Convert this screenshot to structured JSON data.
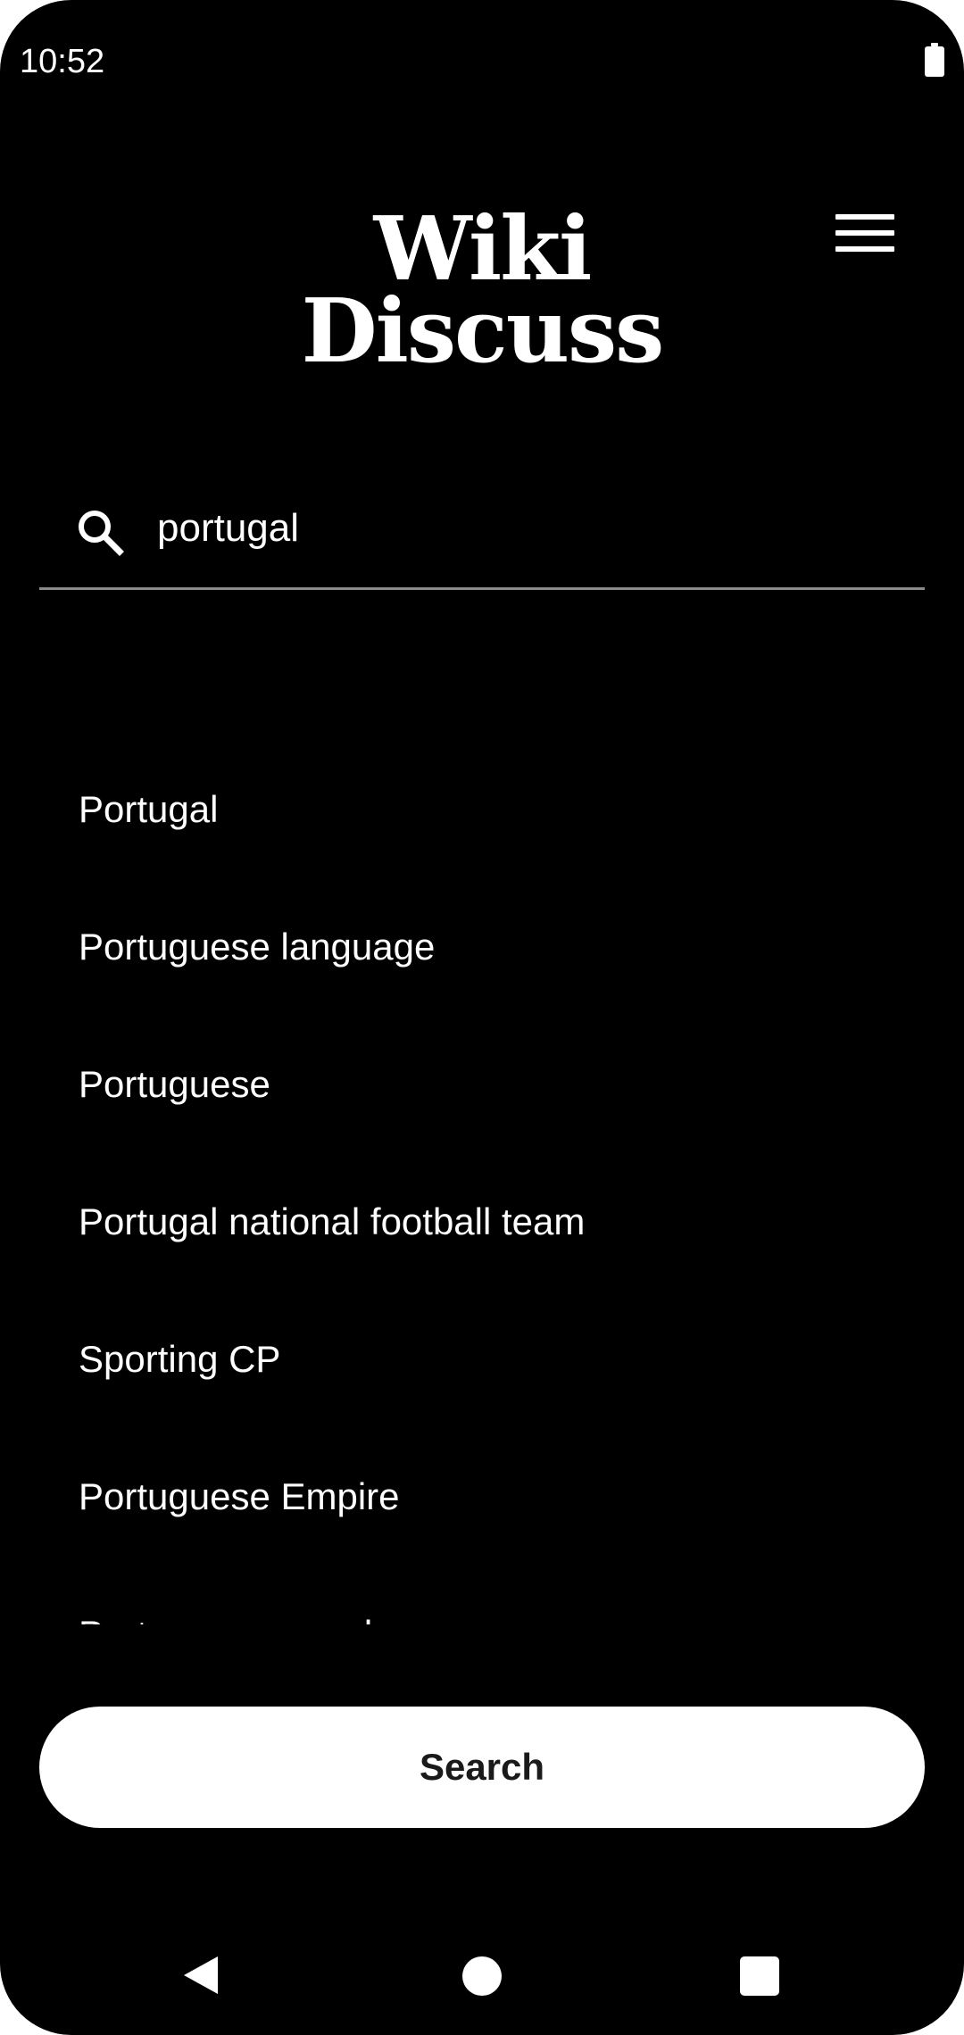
{
  "status_bar": {
    "time": "10:52"
  },
  "header": {
    "logo_line1": "Wiki",
    "logo_line2": "Discuss"
  },
  "search": {
    "value": "portugal",
    "placeholder": ""
  },
  "suggestions": [
    "Portugal",
    "Portuguese language",
    "Portuguese",
    "Portugal national football team",
    "Sporting CP",
    "Portuguese Empire",
    "Portuguese people"
  ],
  "search_button": {
    "label": "Search"
  },
  "icons": {
    "menu": "hamburger-menu-icon",
    "search": "search-icon",
    "battery": "battery-icon",
    "back": "back-triangle-icon",
    "home": "home-circle-icon",
    "recents": "recents-square-icon"
  },
  "colors": {
    "background": "#000000",
    "text": "#ffffff",
    "button_bg": "#ffffff",
    "button_text": "#1a1a1a",
    "divider": "#8a8a8a"
  }
}
